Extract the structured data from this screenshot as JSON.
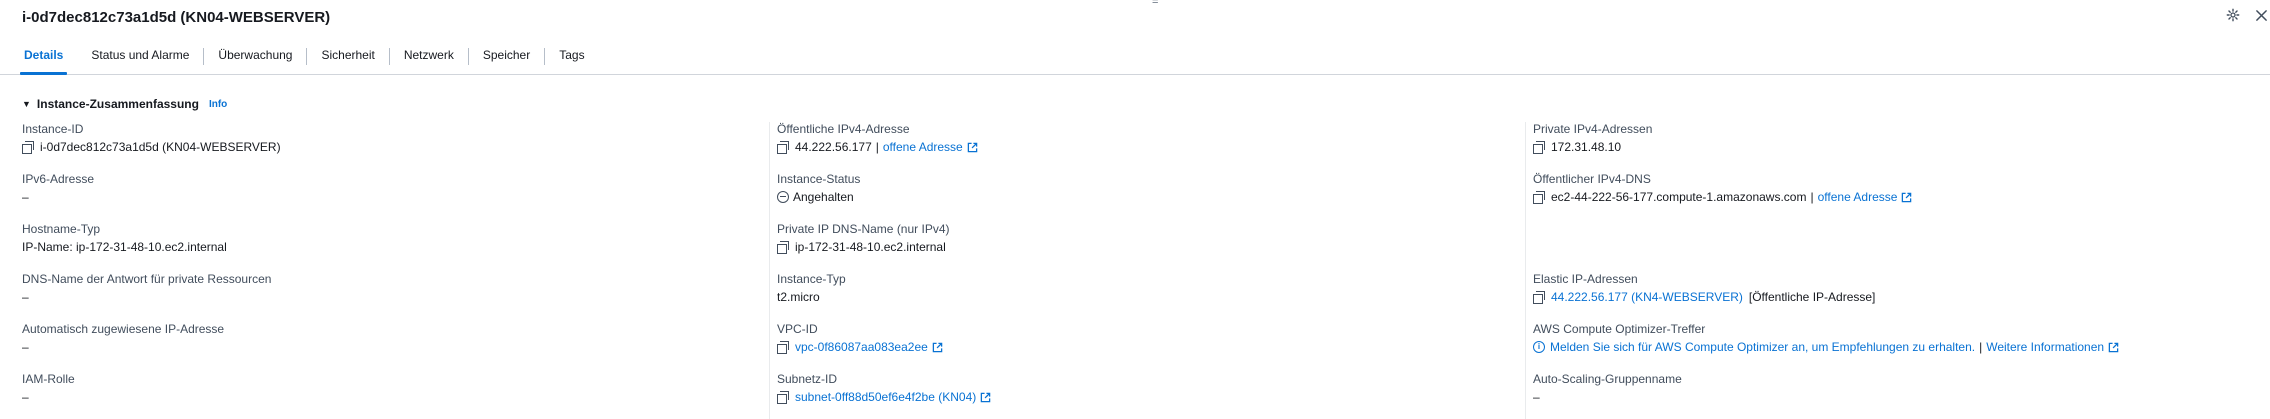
{
  "header": {
    "title": "i-0d7dec812c73a1d5d (KN04-WEBSERVER)",
    "drag_handle": "="
  },
  "tabs": [
    {
      "label": "Details"
    },
    {
      "label": "Status und Alarme"
    },
    {
      "label": "Überwachung"
    },
    {
      "label": "Sicherheit"
    },
    {
      "label": "Netzwerk"
    },
    {
      "label": "Speicher"
    },
    {
      "label": "Tags"
    }
  ],
  "section": {
    "title": "Instance-Zusammenfassung",
    "info_label": "Info"
  },
  "columns": {
    "c1": {
      "instance_id": {
        "label": "Instance-ID",
        "value": "i-0d7dec812c73a1d5d (KN04-WEBSERVER)"
      },
      "ipv6": {
        "label": "IPv6-Adresse",
        "value": "–"
      },
      "hostname_type": {
        "label": "Hostname-Typ",
        "value": "IP-Name: ip-172-31-48-10.ec2.internal"
      },
      "dns_answer": {
        "label": "DNS-Name der Antwort für private Ressourcen",
        "value": "–"
      },
      "auto_ip": {
        "label": "Automatisch zugewiesene IP-Adresse",
        "value": "–"
      },
      "iam_role": {
        "label": "IAM-Rolle",
        "value": "–"
      }
    },
    "c2": {
      "public_ipv4": {
        "label": "Öffentliche IPv4-Adresse",
        "value": "44.222.56.177",
        "separator": "|",
        "link": "offene Adresse"
      },
      "instance_state": {
        "label": "Instance-Status",
        "value": "Angehalten"
      },
      "private_dns": {
        "label": "Private IP DNS-Name (nur IPv4)",
        "value": "ip-172-31-48-10.ec2.internal"
      },
      "instance_type": {
        "label": "Instance-Typ",
        "value": "t2.micro"
      },
      "vpc_id": {
        "label": "VPC-ID",
        "value": "vpc-0f86087aa083ea2ee"
      },
      "subnet_id": {
        "label": "Subnetz-ID",
        "value": "subnet-0ff88d50ef6e4f2be (KN04)"
      }
    },
    "c3": {
      "private_ipv4": {
        "label": "Private IPv4-Adressen",
        "value": "172.31.48.10"
      },
      "public_dns": {
        "label": "Öffentlicher IPv4-DNS",
        "value": "ec2-44-222-56-177.compute-1.amazonaws.com",
        "separator": "|",
        "link": "offene Adresse"
      },
      "elastic_ip": {
        "label": "Elastic IP-Adressen",
        "value": "44.222.56.177 (KN4-WEBSERVER)",
        "suffix": "[Öffentliche IP-Adresse]"
      },
      "optimizer": {
        "label": "AWS Compute Optimizer-Treffer",
        "value": "Melden Sie sich für AWS Compute Optimizer an, um Empfehlungen zu erhalten.",
        "separator": "|",
        "link": "Weitere Informationen"
      },
      "asg": {
        "label": "Auto-Scaling-Gruppenname",
        "value": "–"
      }
    }
  },
  "colors": {
    "accent": "#0972d3",
    "text": "#16191f",
    "label": "#414d5c"
  }
}
